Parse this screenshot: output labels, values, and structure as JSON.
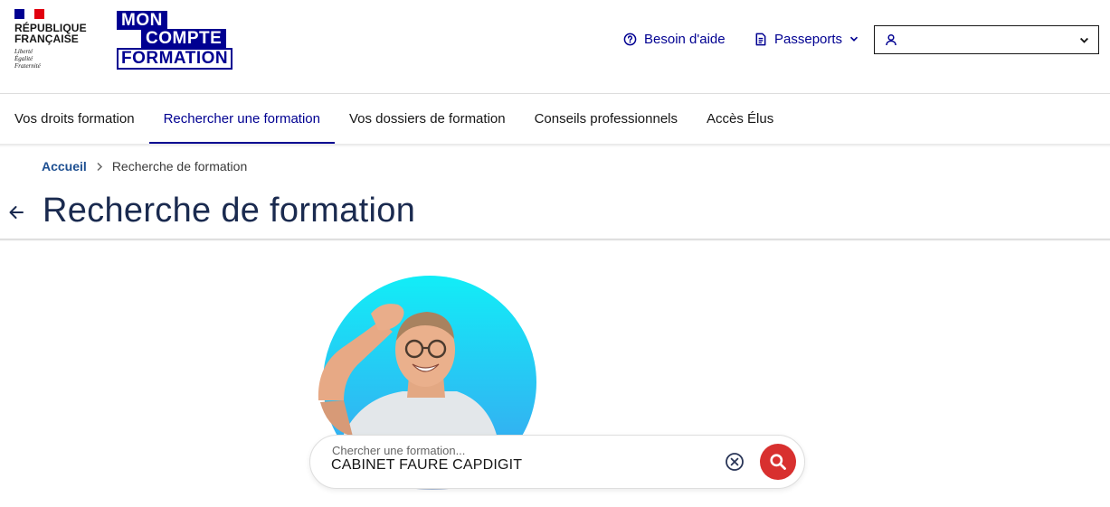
{
  "header": {
    "republic": {
      "name": "RÉPUBLIQUE\nFRANÇAISE",
      "motto": "Liberté\nÉgalité\nFraternité"
    },
    "logo": {
      "line1": "MON",
      "line2": "COMPTE",
      "line3": "FORMATION"
    },
    "help_label": "Besoin d'aide",
    "passports_label": "Passeports",
    "user_select_value": ""
  },
  "nav": {
    "items": [
      {
        "label": "Vos droits formation"
      },
      {
        "label": "Rechercher une formation",
        "active": true
      },
      {
        "label": "Vos dossiers de formation"
      },
      {
        "label": "Conseils professionnels"
      },
      {
        "label": "Accès Élus"
      }
    ]
  },
  "breadcrumb": {
    "home": "Accueil",
    "current": "Recherche de formation"
  },
  "page": {
    "title": "Recherche de formation"
  },
  "search": {
    "label": "Chercher une formation...",
    "value": "CABINET FAURE CAPDIGIT"
  },
  "colors": {
    "brand_blue": "#000091",
    "search_red": "#d8302f",
    "hero_gradient_top": "#19e6f5",
    "hero_gradient_bottom": "#3aa6f0"
  },
  "icons": {
    "help": "question-circle-icon",
    "passports": "document-icon",
    "user": "user-icon",
    "chevron": "chevron-down-icon",
    "back": "arrow-left-icon",
    "clear": "close-circle-icon",
    "search": "search-icon"
  }
}
